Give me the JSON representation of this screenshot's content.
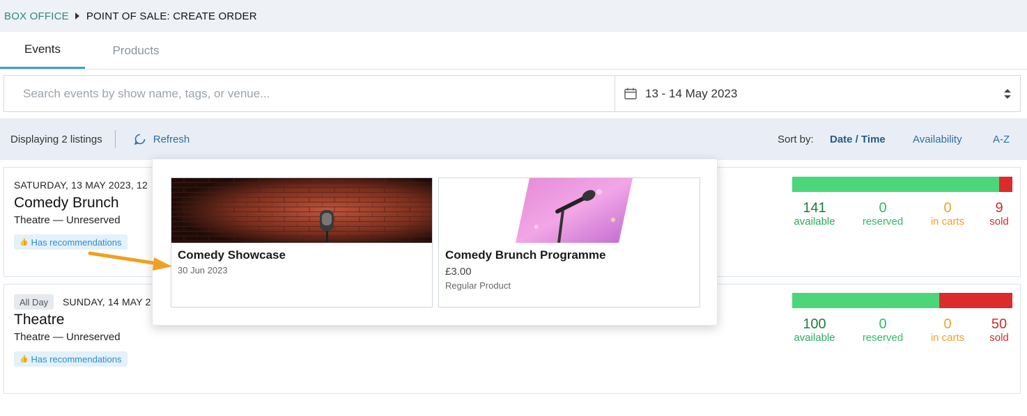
{
  "breadcrumb": {
    "root": "BOX OFFICE",
    "current": "POINT OF SALE: CREATE ORDER"
  },
  "tabs": [
    {
      "label": "Events",
      "active": true
    },
    {
      "label": "Products",
      "active": false
    }
  ],
  "search": {
    "placeholder": "Search events by show name, tags, or venue...",
    "value": ""
  },
  "date_range": {
    "value": "13 - 14 May 2023",
    "icon": "calendar-icon"
  },
  "toolbar": {
    "displaying": "Displaying 2 listings",
    "refresh_label": "Refresh",
    "sort_label": "Sort by:",
    "sort_options": [
      "Date / Time",
      "Availability",
      "A-Z"
    ],
    "active_sort": "Date / Time"
  },
  "listings": [
    {
      "date": "SATURDAY, 13 MAY 2023, 12",
      "all_day": "",
      "title": "Comedy Brunch",
      "venue": "Theatre — Unreserved",
      "badge": "Has recommendations",
      "availability": {
        "available": 141,
        "reserved": 0,
        "in_carts": 0,
        "sold": 9,
        "fraction_available": 0.94
      },
      "labels": {
        "available": "available",
        "reserved": "reserved",
        "in_carts": "in carts",
        "sold": "sold"
      }
    },
    {
      "date": "SUNDAY, 14 MAY 2",
      "all_day": "All Day",
      "title": "Theatre",
      "venue": "Theatre — Unreserved",
      "badge": "Has recommendations",
      "availability": {
        "available": 100,
        "reserved": 0,
        "in_carts": 0,
        "sold": 50,
        "fraction_available": 0.667
      },
      "labels": {
        "available": "available",
        "reserved": "reserved",
        "in_carts": "in carts",
        "sold": "sold"
      }
    }
  ],
  "recommendations": [
    {
      "title": "Comedy Showcase",
      "date": "30 Jun 2023"
    },
    {
      "title": "Comedy Brunch Programme",
      "price": "£3.00",
      "type": "Regular Product"
    }
  ],
  "colors": {
    "accent": "#3aa0d6",
    "available": "#4cd67a",
    "sold": "#dd2a2a",
    "in_carts": "#f0a020"
  }
}
